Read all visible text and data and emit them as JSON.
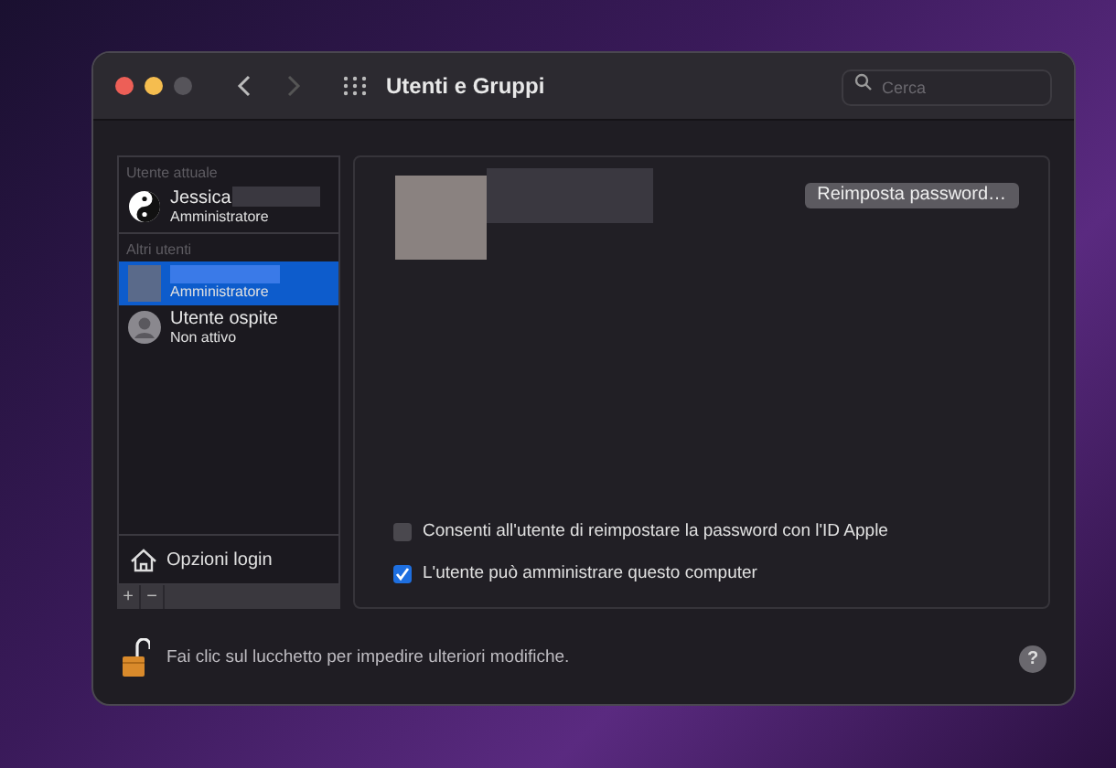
{
  "window": {
    "title": "Utenti e Gruppi",
    "search": {
      "placeholder": "Cerca"
    }
  },
  "sidebar": {
    "sections": [
      {
        "heading": "Utente attuale",
        "users": [
          {
            "kind": "yinyang",
            "name": "Jessica",
            "role": "Amministratore",
            "selected": false
          }
        ]
      },
      {
        "heading": "Altri utenti",
        "users": [
          {
            "kind": "photo",
            "role": "Amministratore",
            "selected": true
          },
          {
            "kind": "guest",
            "name": "Utente ospite",
            "role": "Non attivo",
            "selected": false
          }
        ]
      }
    ],
    "login_options": "Opzioni login",
    "add": "+",
    "remove": "−"
  },
  "detail": {
    "reset_button": "Reimposta password…",
    "options": [
      {
        "label": "Consenti all'utente di reimpostare la password con l'ID Apple",
        "checked": false
      },
      {
        "label": "L'utente può amministrare questo computer",
        "checked": true
      }
    ]
  },
  "footer": {
    "lock_text": "Fai clic sul lucchetto per impedire ulteriori modifiche.",
    "help": "?"
  }
}
